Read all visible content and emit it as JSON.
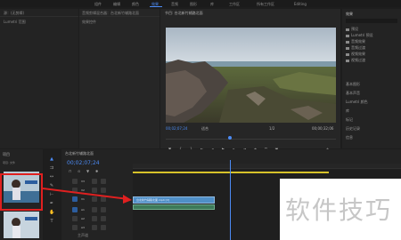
{
  "workspaces": [
    "组件",
    "编辑",
    "颜色",
    "效果",
    "音频",
    "图形",
    "库",
    "工作区",
    "所有工作区",
    "Editing"
  ],
  "active_workspace_index": 3,
  "left_panel_tabs": [
    "源：(无剪辑)",
    "Lumetri 范围"
  ],
  "mid_panel_tabs": [
    "音频剪辑混合器：台北新竹辅路北面",
    "效果控件"
  ],
  "monitor": {
    "title": "节目: 台北新竹辅路北面",
    "timecode_current": "00;02;07;24",
    "fit_label": "适合",
    "quality_label": "1/2",
    "timecode_total": "00;00;32;06"
  },
  "effects_panel": {
    "title": "效果",
    "items": [
      "预设",
      "Lumetri 预设",
      "音频效果",
      "音频过渡",
      "视频效果",
      "视频过渡"
    ],
    "lower_items": [
      "基本图形",
      "基本声音",
      "Lumetri 颜色",
      "库",
      "标记",
      "历史记录",
      "信息"
    ]
  },
  "bin": {
    "title": "项目",
    "subtitle": "项目: 文件"
  },
  "timeline": {
    "title": "台北新竹辅路北面",
    "timecode": "00;02;07;24",
    "tracks": [
      "V3",
      "V2",
      "V1",
      "A1",
      "A2",
      "A3"
    ],
    "clip_v2_label": "台北新竹辅路北面.mp4 [V]",
    "master_label": "主声道"
  },
  "watermark": "软件技巧",
  "colors": {
    "accent": "#4c8bf5",
    "annotation_red": "#e02020",
    "clip_blue": "#4f8fc7"
  }
}
